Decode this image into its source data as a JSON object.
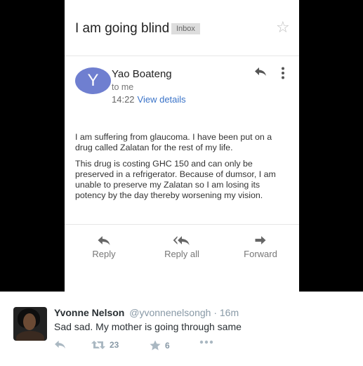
{
  "email": {
    "subject": "I am going blind",
    "folder_badge": "Inbox",
    "avatar_letter": "Y",
    "avatar_color": "#6f7fd0",
    "sender_name": "Yao Boateng",
    "recipient": "to me",
    "time": "14:22",
    "view_details": "View details",
    "body": [
      "I am suffering from glaucoma. I have been put on a drug called Zalatan for the rest of my life.",
      "This drug is costing GHC 150 and can only be preserved in a refrigerator. Because of dumsor, I am unable to preserve my Zalatan so I am losing its potency by the day thereby worsening my vision."
    ],
    "actions": {
      "reply": "Reply",
      "reply_all": "Reply all",
      "forward": "Forward"
    }
  },
  "tweet": {
    "name": "Yvonne Nelson",
    "handle": "@yvonnenelsongh",
    "separator": "·",
    "time": "16m",
    "text": "Sad sad. My mother is going through same",
    "retweets": "23",
    "favorites": "6"
  },
  "icons": {
    "star": "star-outline-icon",
    "reply": "reply-arrow-icon",
    "reply_all": "reply-all-icon",
    "forward": "forward-arrow-icon",
    "more": "more-vertical-icon",
    "retweet": "retweet-icon",
    "favorite": "favorite-star-icon",
    "tweet_more": "more-horizontal-icon"
  }
}
